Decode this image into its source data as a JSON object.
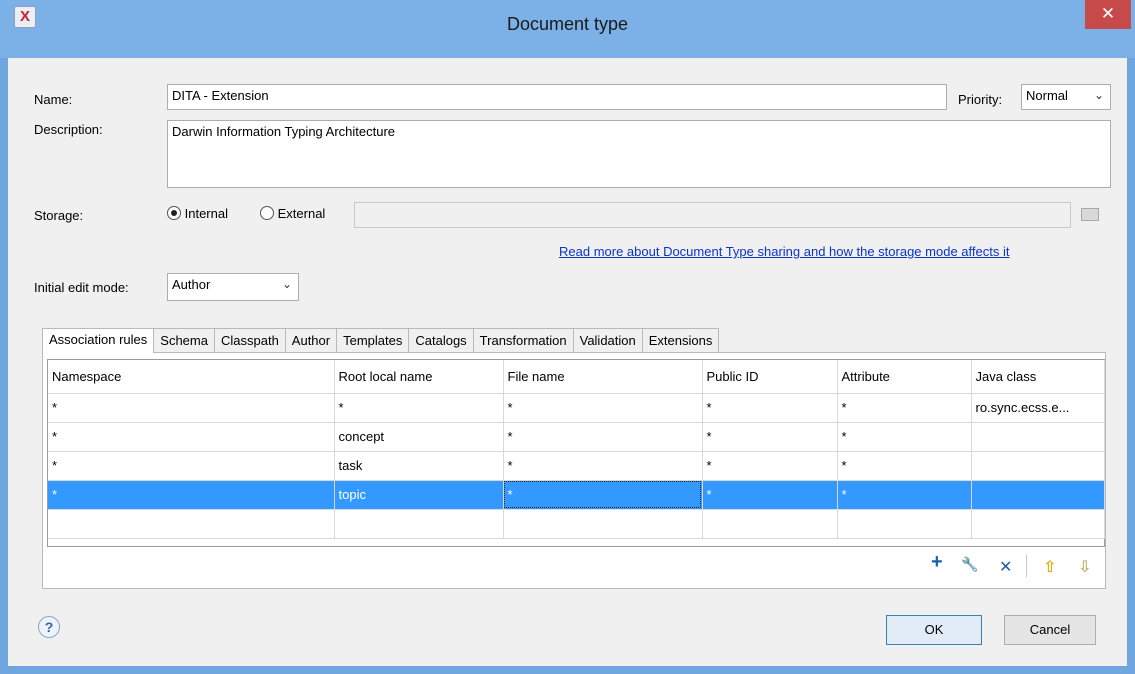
{
  "window": {
    "title": "Document type",
    "close_glyph": "✕",
    "app_icon_glyph": "X"
  },
  "form": {
    "name_label": "Name:",
    "name_value": "DITA - Extension",
    "priority_label": "Priority:",
    "priority_value": "Normal",
    "description_label": "Description:",
    "description_value": "Darwin Information Typing Architecture",
    "storage_label": "Storage:",
    "storage_internal": "Internal",
    "storage_external": "External",
    "storage_selected": "Internal",
    "external_path_value": "",
    "storage_link": "Read more about Document Type sharing and how the storage mode affects it",
    "initial_edit_mode_label": "Initial edit mode:",
    "initial_edit_mode_value": "Author"
  },
  "tabs": [
    {
      "label": "Association rules",
      "active": true
    },
    {
      "label": "Schema"
    },
    {
      "label": "Classpath"
    },
    {
      "label": "Author"
    },
    {
      "label": "Templates"
    },
    {
      "label": "Catalogs"
    },
    {
      "label": "Transformation"
    },
    {
      "label": "Validation"
    },
    {
      "label": "Extensions"
    }
  ],
  "table": {
    "columns": [
      "Namespace",
      "Root local name",
      "File name",
      "Public ID",
      "Attribute",
      "Java class"
    ],
    "rows": [
      [
        "*",
        "*",
        "*",
        "*",
        "*",
        "ro.sync.ecss.e..."
      ],
      [
        "*",
        "concept",
        "*",
        "*",
        "*",
        ""
      ],
      [
        "*",
        "task",
        "*",
        "*",
        "*",
        ""
      ],
      [
        "*",
        "topic",
        "*",
        "*",
        "*",
        ""
      ],
      [
        "",
        "",
        "",
        "",
        "",
        ""
      ]
    ],
    "selected_row": 3
  },
  "table_toolbar": {
    "add_glyph": "+",
    "edit_glyph": "🔧",
    "remove_glyph": "✕",
    "up_glyph": "⇧",
    "down_glyph": "⇩"
  },
  "footer": {
    "help_glyph": "?",
    "ok_label": "OK",
    "cancel_label": "Cancel"
  },
  "colors": {
    "accent": "#3399ff",
    "link": "#0b34c8",
    "close": "#c74a4a"
  }
}
